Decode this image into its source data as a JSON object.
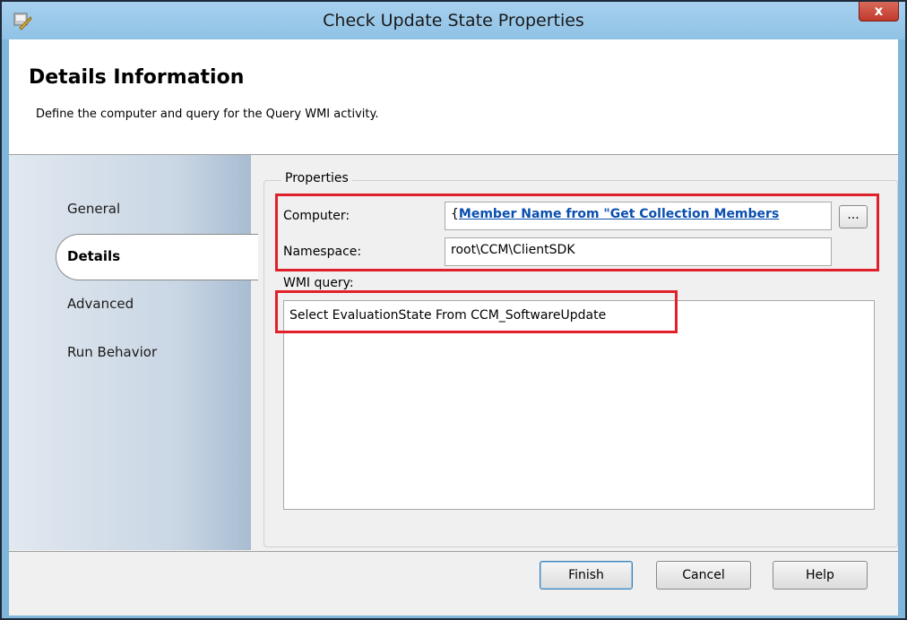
{
  "window": {
    "title": "Check Update State  Properties",
    "close_glyph": "x",
    "icon": "runbook-activity-icon"
  },
  "header": {
    "title": "Details Information",
    "subtitle": "Define the computer and query for the Query WMI activity."
  },
  "nav": {
    "items": [
      {
        "label": "General"
      },
      {
        "label": "Details",
        "selected": true
      },
      {
        "label": "Advanced"
      },
      {
        "label": "Run Behavior"
      }
    ]
  },
  "properties": {
    "group_label": "Properties",
    "computer_label": "Computer:",
    "computer_value_prefix": "{",
    "computer_value_link": "Member Name from \"Get Collection Members",
    "browse_label": "...",
    "namespace_label": "Namespace:",
    "namespace_value": "root\\CCM\\ClientSDK",
    "wmi_query_label": "WMI query:",
    "wmi_query_value": "Select EvaluationState From CCM_SoftwareUpdate"
  },
  "footer": {
    "finish_label": "Finish",
    "cancel_label": "Cancel",
    "help_label": "Help"
  },
  "colors": {
    "highlight_box": "#e0202a",
    "link": "#0b4fb0",
    "title_bar": "#9cc9ea"
  }
}
